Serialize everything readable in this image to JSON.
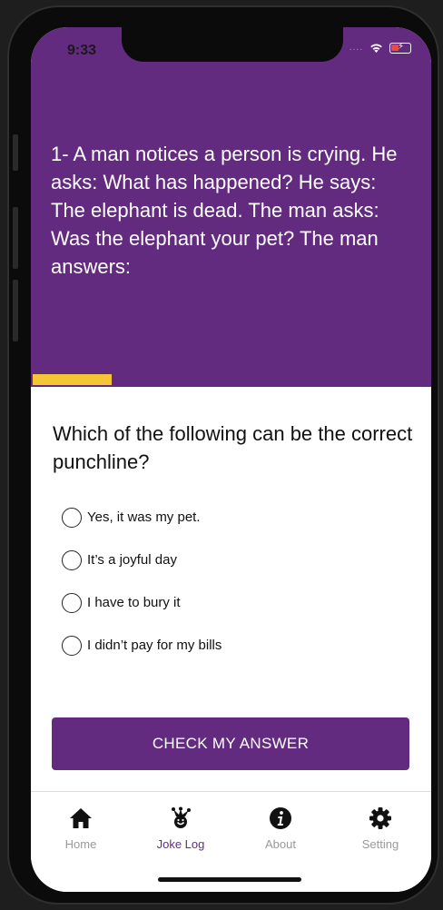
{
  "status": {
    "time": "9:33",
    "dots": "....",
    "battery_color": "#e74c3c"
  },
  "joke": {
    "text": "1- A man notices a person is crying. He asks: What has happened? He says: The elephant is dead. The man asks: Was the elephant your pet? The man answers:"
  },
  "progress": {
    "fraction": 0.2,
    "color": "#f4c534"
  },
  "question": {
    "text": "Which of the following can be the correct punchline?"
  },
  "options": [
    {
      "label": "Yes, it was my pet."
    },
    {
      "label": "It’s a joyful day"
    },
    {
      "label": "I have to bury it"
    },
    {
      "label": "I didn’t pay for my bills"
    }
  ],
  "check_button": {
    "label": "CHECK MY ANSWER"
  },
  "tabs": [
    {
      "label": "Home",
      "icon": "home-icon"
    },
    {
      "label": "Joke Log",
      "icon": "jester-icon",
      "active": true
    },
    {
      "label": "About",
      "icon": "info-icon"
    },
    {
      "label": "Setting",
      "icon": "gear-icon"
    }
  ],
  "colors": {
    "primary": "#632b7f",
    "accent": "#f4c534",
    "inactive_tab": "#999999"
  }
}
